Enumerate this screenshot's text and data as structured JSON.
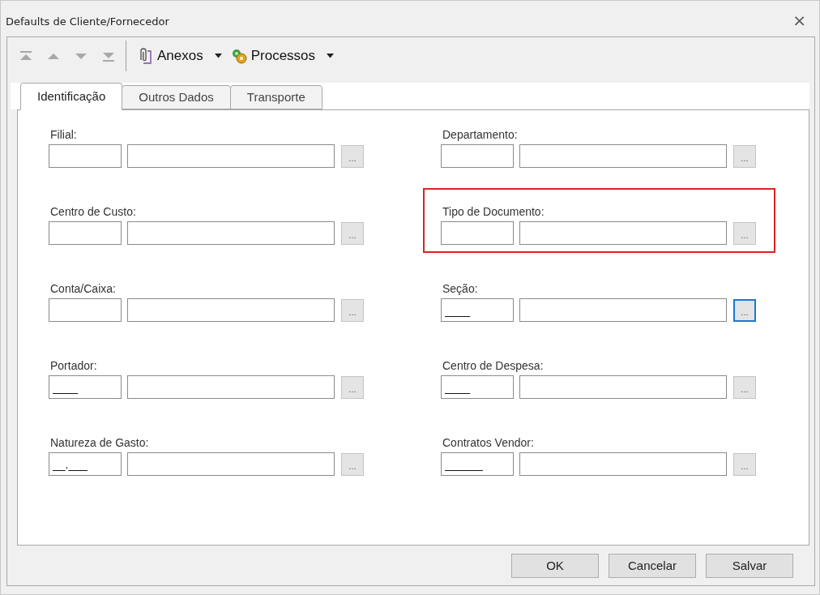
{
  "window": {
    "title": "Defaults de Cliente/Fornecedor",
    "close": "×"
  },
  "toolbar": {
    "nav_disabled": true,
    "items": [
      {
        "label": "Anexos",
        "kind": "clip"
      },
      {
        "label": "Processos",
        "kind": "gears"
      }
    ]
  },
  "tabs": [
    {
      "label": "Identificação",
      "selected": true
    },
    {
      "label": "Outros Dados",
      "selected": false
    },
    {
      "label": "Transporte",
      "selected": false
    }
  ],
  "columns": [
    {
      "fields": [
        {
          "label": "Filial:",
          "lookup_focused": false,
          "highlighted": false
        },
        {
          "label": "Centro de Custo:",
          "lookup_focused": false,
          "highlighted": false
        },
        {
          "label": "Conta/Caixa:",
          "lookup_focused": false,
          "highlighted": false
        },
        {
          "label": "Portador:",
          "code": "____",
          "lookup_focused": false,
          "highlighted": false
        },
        {
          "label": "Natureza de Gasto:",
          "code": "__.___",
          "lookup_focused": false,
          "highlighted": false
        }
      ]
    },
    {
      "fields": [
        {
          "label": "Departamento:",
          "lookup_focused": false,
          "highlighted": false
        },
        {
          "label": "Tipo de Documento:",
          "lookup_focused": false,
          "highlighted": true
        },
        {
          "label": "Seção:",
          "code": "____",
          "lookup_focused": true,
          "highlighted": false
        },
        {
          "label": "Centro de Despesa:",
          "code": "____",
          "lookup_focused": false,
          "highlighted": false
        },
        {
          "label": "Contratos Vendor:",
          "code": "______",
          "lookup_focused": false,
          "highlighted": false
        }
      ]
    }
  ],
  "lookup_button": "...",
  "buttons": [
    "OK",
    "Cancelar",
    "Salvar"
  ]
}
